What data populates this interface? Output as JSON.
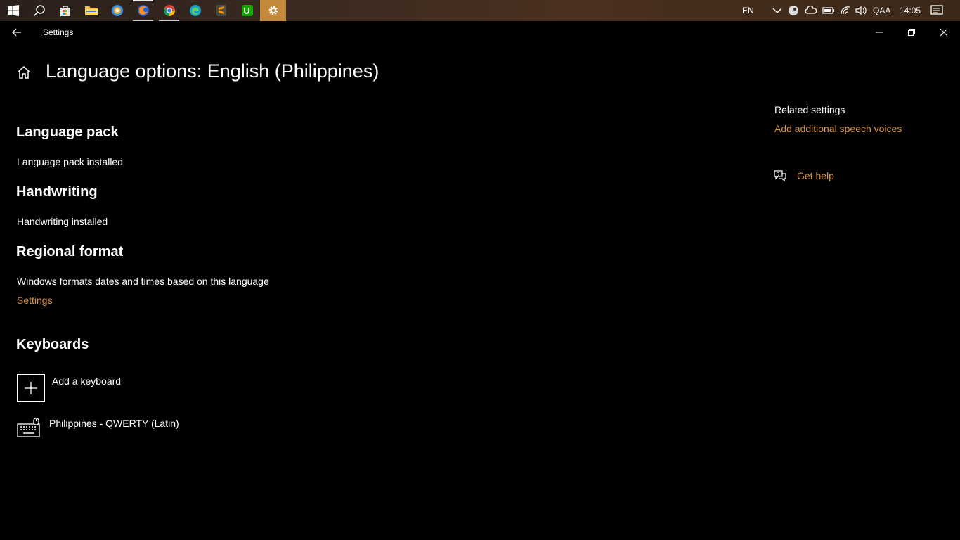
{
  "taskbar": {
    "icons": [
      "windows-start-icon",
      "search-icon",
      "store-icon",
      "file-explorer-icon",
      "app-icon",
      "firefox-icon",
      "chrome-icon",
      "edge-icon",
      "sublime-icon",
      "upwork-icon",
      "settings-gear-icon"
    ],
    "language": "EN",
    "user": "QAA",
    "time": "14:05"
  },
  "window": {
    "title": "Settings"
  },
  "page": {
    "title": "Language options: English (Philippines)"
  },
  "language_pack": {
    "heading": "Language pack",
    "status": "Language pack installed"
  },
  "handwriting": {
    "heading": "Handwriting",
    "status": "Handwriting installed"
  },
  "regional_format": {
    "heading": "Regional format",
    "description": "Windows formats dates and times based on this language",
    "link": "Settings"
  },
  "keyboards": {
    "heading": "Keyboards",
    "add_label": "Add a keyboard",
    "items": [
      {
        "label": "Philippines - QWERTY (Latin)"
      }
    ]
  },
  "sidebar": {
    "related_heading": "Related settings",
    "related_link": "Add additional speech voices",
    "help_link": "Get help"
  },
  "colors": {
    "accent": "#d99346",
    "taskbar_active": "#c38a3c",
    "background": "#000000"
  }
}
